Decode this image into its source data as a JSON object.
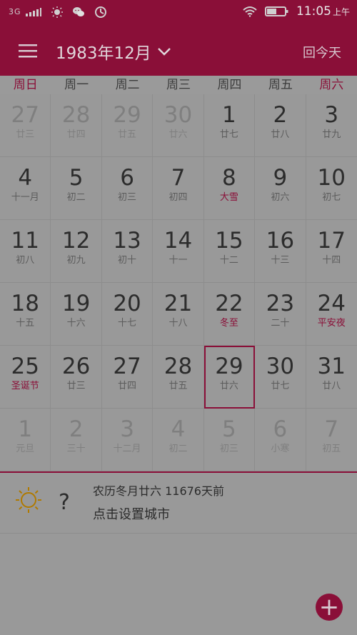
{
  "status_bar": {
    "network": "3G",
    "time": "11:05",
    "ampm": "上午"
  },
  "header": {
    "title": "1983年12月",
    "today_label": "回今天"
  },
  "weekdays": [
    "周日",
    "周一",
    "周二",
    "周三",
    "周四",
    "周五",
    "周六"
  ],
  "calendar": {
    "weeks": [
      [
        {
          "day": "27",
          "lunar": "廿三",
          "muted": true
        },
        {
          "day": "28",
          "lunar": "廿四",
          "muted": true
        },
        {
          "day": "29",
          "lunar": "廿五",
          "muted": true
        },
        {
          "day": "30",
          "lunar": "廿六",
          "muted": true
        },
        {
          "day": "1",
          "lunar": "廿七"
        },
        {
          "day": "2",
          "lunar": "廿八"
        },
        {
          "day": "3",
          "lunar": "廿九"
        }
      ],
      [
        {
          "day": "4",
          "lunar": "十一月"
        },
        {
          "day": "5",
          "lunar": "初二"
        },
        {
          "day": "6",
          "lunar": "初三"
        },
        {
          "day": "7",
          "lunar": "初四"
        },
        {
          "day": "8",
          "lunar": "大雪",
          "red": true
        },
        {
          "day": "9",
          "lunar": "初六"
        },
        {
          "day": "10",
          "lunar": "初七"
        }
      ],
      [
        {
          "day": "11",
          "lunar": "初八"
        },
        {
          "day": "12",
          "lunar": "初九"
        },
        {
          "day": "13",
          "lunar": "初十"
        },
        {
          "day": "14",
          "lunar": "十一"
        },
        {
          "day": "15",
          "lunar": "十二"
        },
        {
          "day": "16",
          "lunar": "十三"
        },
        {
          "day": "17",
          "lunar": "十四"
        }
      ],
      [
        {
          "day": "18",
          "lunar": "十五"
        },
        {
          "day": "19",
          "lunar": "十六"
        },
        {
          "day": "20",
          "lunar": "十七"
        },
        {
          "day": "21",
          "lunar": "十八"
        },
        {
          "day": "22",
          "lunar": "冬至",
          "red": true
        },
        {
          "day": "23",
          "lunar": "二十"
        },
        {
          "day": "24",
          "lunar": "平安夜",
          "red": true
        }
      ],
      [
        {
          "day": "25",
          "lunar": "圣诞节",
          "red": true
        },
        {
          "day": "26",
          "lunar": "廿三"
        },
        {
          "day": "27",
          "lunar": "廿四"
        },
        {
          "day": "28",
          "lunar": "廿五"
        },
        {
          "day": "29",
          "lunar": "廿六",
          "selected": true
        },
        {
          "day": "30",
          "lunar": "廿七"
        },
        {
          "day": "31",
          "lunar": "廿八"
        }
      ],
      [
        {
          "day": "1",
          "lunar": "元旦",
          "muted": true
        },
        {
          "day": "2",
          "lunar": "三十",
          "muted": true
        },
        {
          "day": "3",
          "lunar": "十二月",
          "muted": true
        },
        {
          "day": "4",
          "lunar": "初二",
          "muted": true
        },
        {
          "day": "5",
          "lunar": "初三",
          "muted": true
        },
        {
          "day": "6",
          "lunar": "小寒",
          "muted": true
        },
        {
          "day": "7",
          "lunar": "初五",
          "muted": true
        }
      ]
    ]
  },
  "weather": {
    "lunar_info": "农历冬月廿六 11676天前",
    "city_prompt": "点击设置城市",
    "question": "?"
  },
  "fab": {
    "label": "+"
  },
  "colors": {
    "accent": "#8a0f38"
  }
}
